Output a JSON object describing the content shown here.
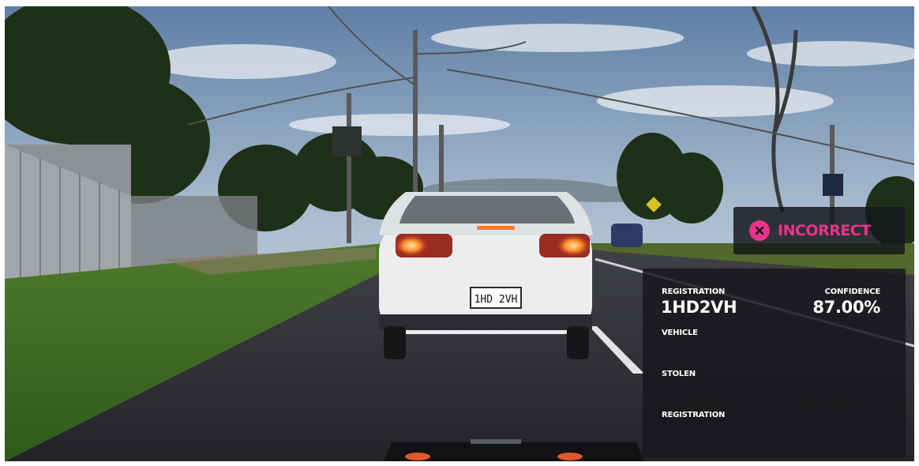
{
  "status": {
    "text": "INCORRECT",
    "icon": "close-circle-icon",
    "color": "#e8348a"
  },
  "panel": {
    "registration_label": "REGISTRATION",
    "registration_value": "1HD2VH",
    "confidence_label": "CONFIDENCE",
    "confidence_value": "87.00%",
    "vehicle_label": "VEHICLE",
    "stolen_label": "STOLEN",
    "registration_label_2": "REGISTRATION"
  },
  "scene": {
    "plate_text": "1HD 2VH"
  }
}
